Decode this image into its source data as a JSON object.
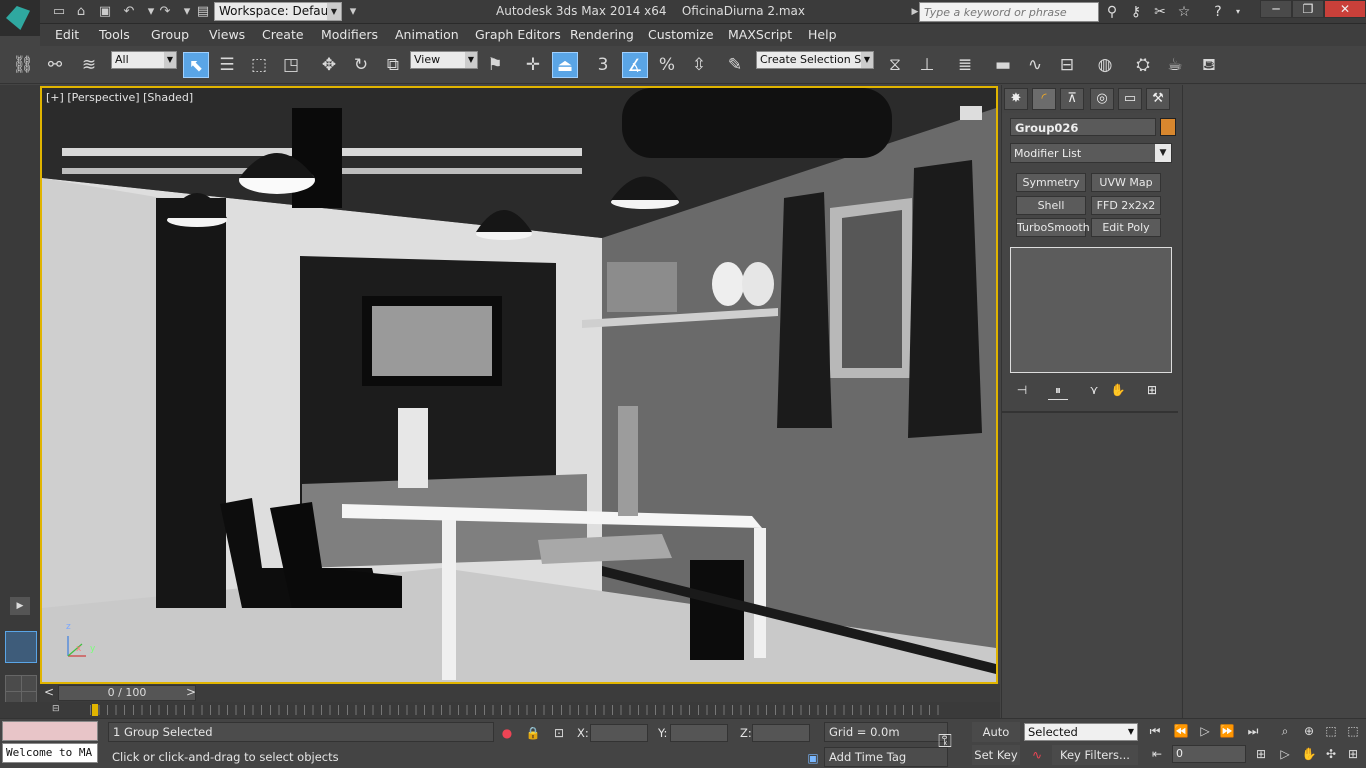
{
  "titlebar": {
    "workspace_label": "Workspace: Default",
    "app_title": "Autodesk 3ds Max  2014 x64",
    "file_name": "OficinaDiurna 2.max",
    "search_placeholder": "Type a keyword or phrase",
    "minimize": "─",
    "maximize": "❐",
    "close": "✕"
  },
  "menu": [
    "Edit",
    "Tools",
    "Group",
    "Views",
    "Create",
    "Modifiers",
    "Animation",
    "Graph Editors",
    "Rendering",
    "Customize",
    "MAXScript",
    "Help"
  ],
  "toolbar": {
    "selection_filter": "All",
    "ref_coord": "View",
    "named_selection": "Create Selection Se",
    "snap_toggle": "3",
    "percent_snap": "%"
  },
  "viewport": {
    "label_plus": "[+]",
    "label_view": "[Perspective]",
    "label_shading": "[Shaded]",
    "axis_z": "z",
    "axis_x": "x",
    "axis_y": "y"
  },
  "command_panel": {
    "object_name": "Group026",
    "object_color": "#d8872e",
    "modifier_list": "Modifier List",
    "buttons": [
      "Symmetry",
      "UVW Map",
      "Shell",
      "FFD 2x2x2",
      "TurboSmooth",
      "Edit Poly"
    ]
  },
  "timeline": {
    "frame_display": "0 / 100",
    "prev": "<",
    "next": ">"
  },
  "status": {
    "listener_text": "Welcome to MA",
    "selection_count": "1 Group Selected",
    "prompt": "Click or click-and-drag to select objects",
    "x_label": "X:",
    "y_label": "Y:",
    "z_label": "Z:",
    "grid": "Grid = 0.0m",
    "add_time_tag": "Add Time Tag",
    "auto_key": "Auto Key",
    "set_key": "Set Key",
    "key_mode": "Selected",
    "key_filters": "Key Filters...",
    "current_frame": "0"
  },
  "colors": {
    "accent": "#e0b400",
    "active_tool": "#5aa5e6",
    "panel": "#454545"
  }
}
